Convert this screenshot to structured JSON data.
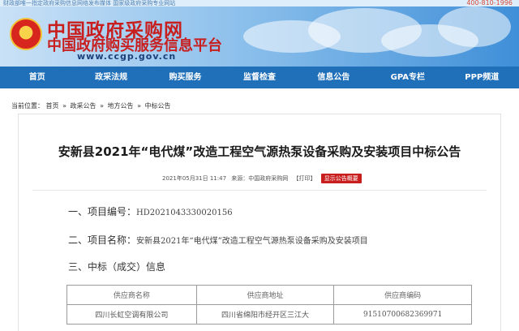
{
  "header": {
    "topbar_text": "财政部唯一指定政府采购信息网络发布媒体  国家级政府采购专业网站",
    "hotline": "400-810-1996",
    "title": "中国政府采购网",
    "subtitle": "中国政府购买服务信息平台",
    "url": "www.ccgp.gov.cn"
  },
  "nav": {
    "items": [
      "首页",
      "政采法规",
      "购买服务",
      "监督检查",
      "信息公告",
      "GPA专栏",
      "PPP频道"
    ]
  },
  "breadcrumb": {
    "prefix": "当前位置：",
    "items": [
      "首页",
      "政采公告",
      "地方公告",
      "中标公告"
    ],
    "separator": "»"
  },
  "article": {
    "title": "安新县2021年“电代煤”改造工程空气源热泵设备采购及安装项目中标公告",
    "date": "2021年05月31日 11:47",
    "source": "来源：中国政府采购网",
    "print": "【打印】",
    "summary_badge": "显示公告概要",
    "item1_label": "一、项目编号：",
    "item1_value": "HD2021043330020156",
    "item2_label": "二、项目名称：",
    "item2_value": "安新县2021年“电代煤”改造工程空气源热泵设备采购及安装项目",
    "item3_label": "三、中标（成交）信息"
  },
  "table": {
    "headers": [
      "供应商名称",
      "供应商地址",
      "供应商编码"
    ],
    "rows": [
      [
        "四川长虹空调有限公司",
        "四川省绵阳市经开区三江大",
        "91510700682369971"
      ]
    ]
  },
  "colors": {
    "brand_red": "#c81e1e",
    "nav_blue": "#1f6fb9"
  }
}
